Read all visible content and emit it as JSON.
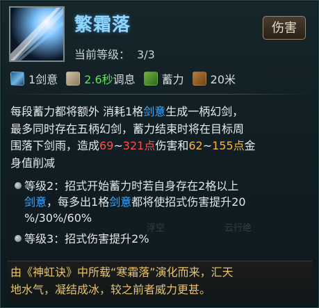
{
  "skill": {
    "icon_name": "frost-sword-skill-icon",
    "title": "繁霜落",
    "level_label": "当前等级：",
    "level_value": "3/3",
    "damage_badge": "伤害"
  },
  "stats": {
    "sword_intent": "1剑意",
    "cooldown_value": "2.6秒",
    "cooldown_suffix": "调息",
    "charge": "蓄力",
    "range": "20米"
  },
  "description": {
    "line1_part1": "每段蓄力都将额外 消耗1格",
    "line1_kw": "剑意",
    "line1_part2": "生成一柄幻剑，",
    "line2": "最多同时存在五柄幻剑，蓄力结束时将在目标周",
    "line3_part1": "围落下剑雨，造成",
    "line3_dmg1_low": "69",
    "line3_tilde": "~",
    "line3_dmg1_high": "321点",
    "line3_part2": "伤害和",
    "line3_dmg2_low": "62",
    "line3_tilde2": "~",
    "line3_dmg2_high": "155点",
    "line3_part3": "金",
    "line4": "身值削减"
  },
  "levels": [
    {
      "line1": "等级2：招式开始蓄力时若自身存在2格以上",
      "line2_kw1": "剑意",
      "line2_part": "，每多出1格",
      "line2_kw2": "剑意",
      "line2_rest": "都将使招式伤害提升20",
      "line3": "%/30%/60%"
    },
    {
      "line1": "等级3：招式伤害提升2%"
    }
  ],
  "lore": {
    "line1": "由《神虹诀》中所载“寒霜落”演化而来，汇天",
    "line2": "地水气，凝结成冰，较之前者威力更甚。"
  },
  "watermarks": {
    "left": "浮空",
    "right": "云行绝"
  },
  "colors": {
    "title": "#8fd6ff",
    "keyword_blue": "#3ea9ff",
    "damage_red": "#ff4d4d",
    "damage_orange": "#ffb23a",
    "cooldown_green": "#5fe35f",
    "lore_gold": "#e7c36b"
  }
}
